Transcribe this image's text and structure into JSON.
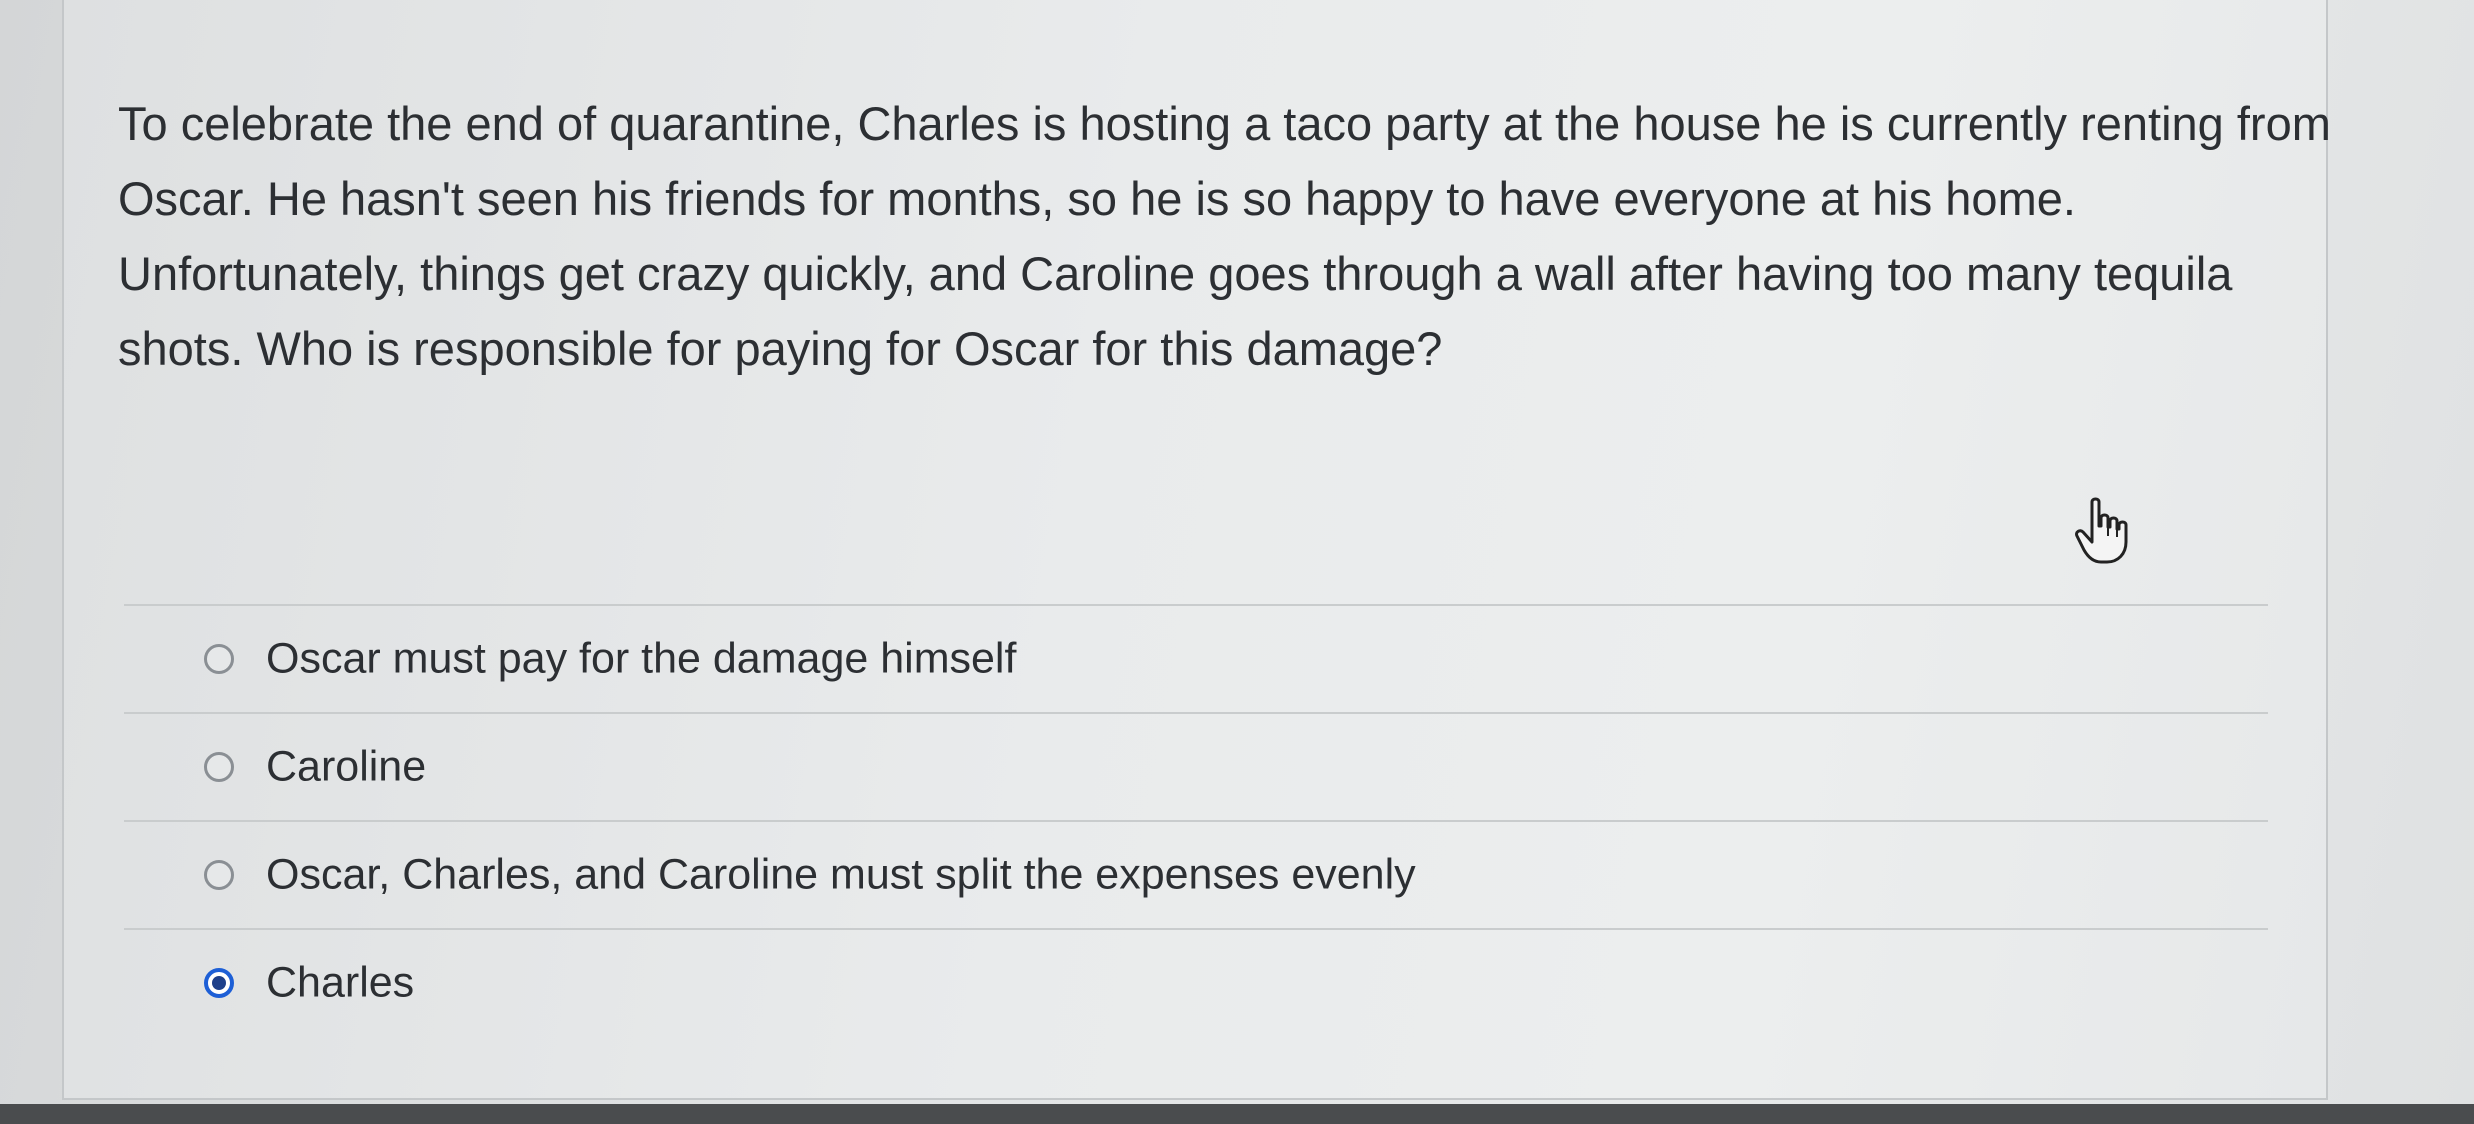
{
  "question": {
    "text": "To celebrate the end of quarantine, Charles is hosting a taco party at the house he is currently renting from Oscar. He hasn't seen his friends for months, so he is so happy to have everyone at his home. Unfortunately, things get crazy quickly, and Caroline goes through a wall after having too many tequila shots. Who is responsible for paying for Oscar for this damage?"
  },
  "answers": [
    {
      "label": "Oscar must pay for the damage himself",
      "selected": false
    },
    {
      "label": "Caroline",
      "selected": false
    },
    {
      "label": "Oscar, Charles, and Caroline must split the expenses evenly",
      "selected": false
    },
    {
      "label": "Charles",
      "selected": true
    }
  ],
  "colors": {
    "selected_radio": "#1d5fd6",
    "text": "#2c2f33"
  },
  "icons": {
    "cursor": "hand-pointer-icon"
  }
}
